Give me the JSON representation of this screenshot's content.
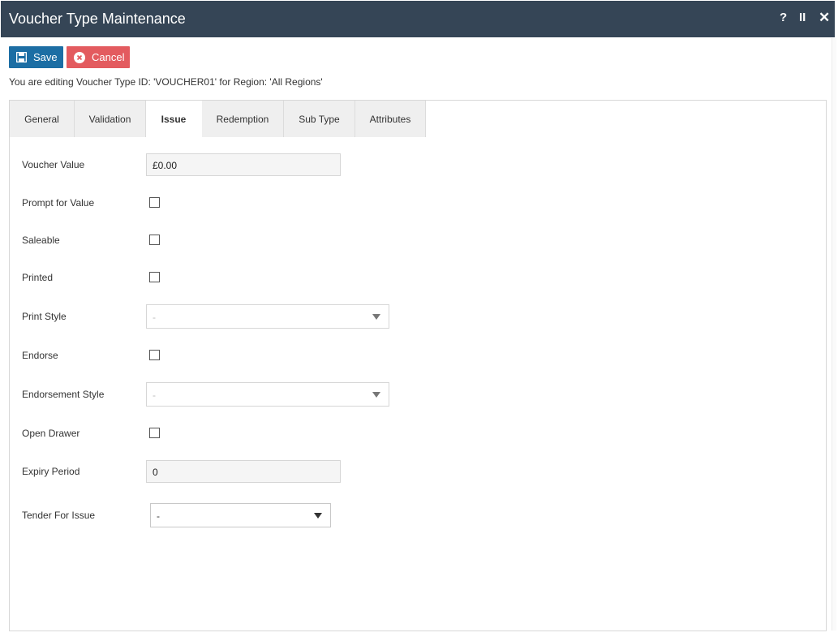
{
  "window": {
    "title": "Voucher Type Maintenance",
    "help": "?",
    "pause": "II",
    "close": "✕"
  },
  "toolbar": {
    "save_label": "Save",
    "cancel_label": "Cancel"
  },
  "info_text": "You are editing Voucher Type ID: 'VOUCHER01' for Region: 'All Regions'",
  "tabs": [
    {
      "label": "General"
    },
    {
      "label": "Validation"
    },
    {
      "label": "Issue"
    },
    {
      "label": "Redemption"
    },
    {
      "label": "Sub Type"
    },
    {
      "label": "Attributes"
    }
  ],
  "active_tab": "Issue",
  "form": {
    "voucher_value": {
      "label": "Voucher Value",
      "value": "£0.00"
    },
    "prompt_for_value": {
      "label": "Prompt for Value",
      "checked": false
    },
    "saleable": {
      "label": "Saleable",
      "checked": false
    },
    "printed": {
      "label": "Printed",
      "checked": false
    },
    "print_style": {
      "label": "Print Style",
      "value": "-"
    },
    "endorse": {
      "label": "Endorse",
      "checked": false
    },
    "endorsement_style": {
      "label": "Endorsement Style",
      "value": "-"
    },
    "open_drawer": {
      "label": "Open Drawer",
      "checked": false
    },
    "expiry_period": {
      "label": "Expiry Period",
      "value": "0"
    },
    "tender_for_issue": {
      "label": "Tender For Issue",
      "value": "-"
    }
  },
  "colors": {
    "titlebar": "#354556",
    "save": "#1c6ea4",
    "cancel": "#e35b5f"
  }
}
